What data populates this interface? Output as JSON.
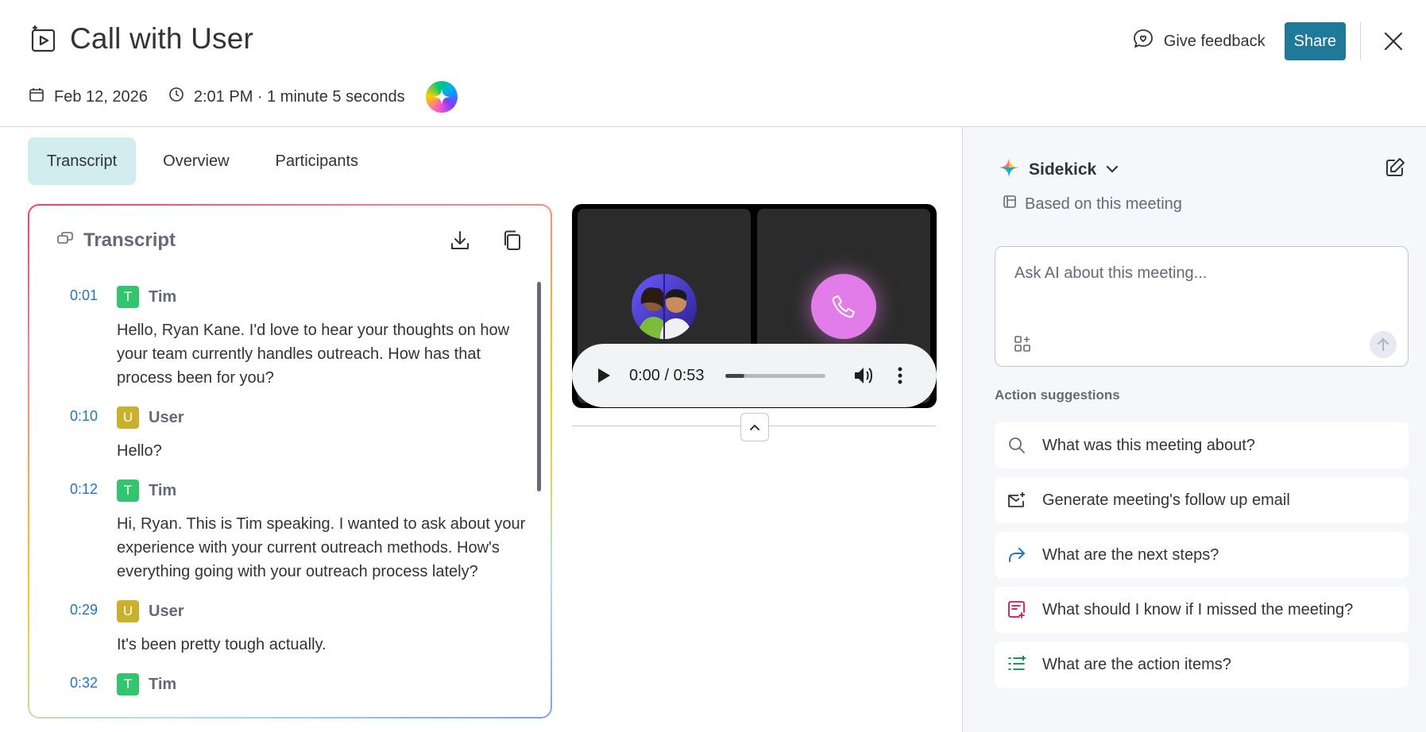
{
  "header": {
    "title": "Call with User",
    "date": "Feb 12, 2026",
    "time": "2:01 PM · 1 minute 5 seconds",
    "feedback_label": "Give feedback",
    "share_label": "Share"
  },
  "tabs": [
    {
      "label": "Transcript",
      "active": true
    },
    {
      "label": "Overview",
      "active": false
    },
    {
      "label": "Participants",
      "active": false
    }
  ],
  "transcript": {
    "title": "Transcript",
    "entries": [
      {
        "time": "0:01",
        "initial": "T",
        "speaker": "Tim",
        "color": "#33c46f",
        "text": "Hello, Ryan Kane. I'd love to hear your thoughts on how your team currently handles outreach. How has that process been for you?"
      },
      {
        "time": "0:10",
        "initial": "U",
        "speaker": "User",
        "color": "#c9b12c",
        "text": "Hello?"
      },
      {
        "time": "0:12",
        "initial": "T",
        "speaker": "Tim",
        "color": "#33c46f",
        "text": "Hi, Ryan. This is Tim speaking. I wanted to ask about your experience with your current outreach methods. How's everything going with your outreach process lately?"
      },
      {
        "time": "0:29",
        "initial": "U",
        "speaker": "User",
        "color": "#c9b12c",
        "text": "It's been pretty tough actually."
      },
      {
        "time": "0:32",
        "initial": "T",
        "speaker": "Tim",
        "color": "#33c46f",
        "text": ""
      }
    ]
  },
  "player": {
    "time_display": "0:00 / 0:53",
    "progress": 0.0
  },
  "sidebar": {
    "title": "Sidekick",
    "context": "Based on this meeting",
    "ask_placeholder": "Ask AI about this meeting...",
    "suggestions_title": "Action suggestions",
    "suggestions": [
      {
        "label": "What was this meeting about?",
        "icon": "search-icon"
      },
      {
        "label": "Generate meeting's follow up email",
        "icon": "mail-sparkle-icon"
      },
      {
        "label": "What are the next steps?",
        "icon": "forward-arrow-icon"
      },
      {
        "label": "What should I know if I missed the meeting?",
        "icon": "note-plus-icon"
      },
      {
        "label": "What are the action items?",
        "icon": "checklist-icon"
      }
    ]
  },
  "colors": {
    "accent": "#1f7a99",
    "tab_active_bg": "#d2edf0",
    "timestamp": "#1f76c2",
    "tim_avatar": "#33c46f",
    "user_avatar": "#c9b12c"
  }
}
